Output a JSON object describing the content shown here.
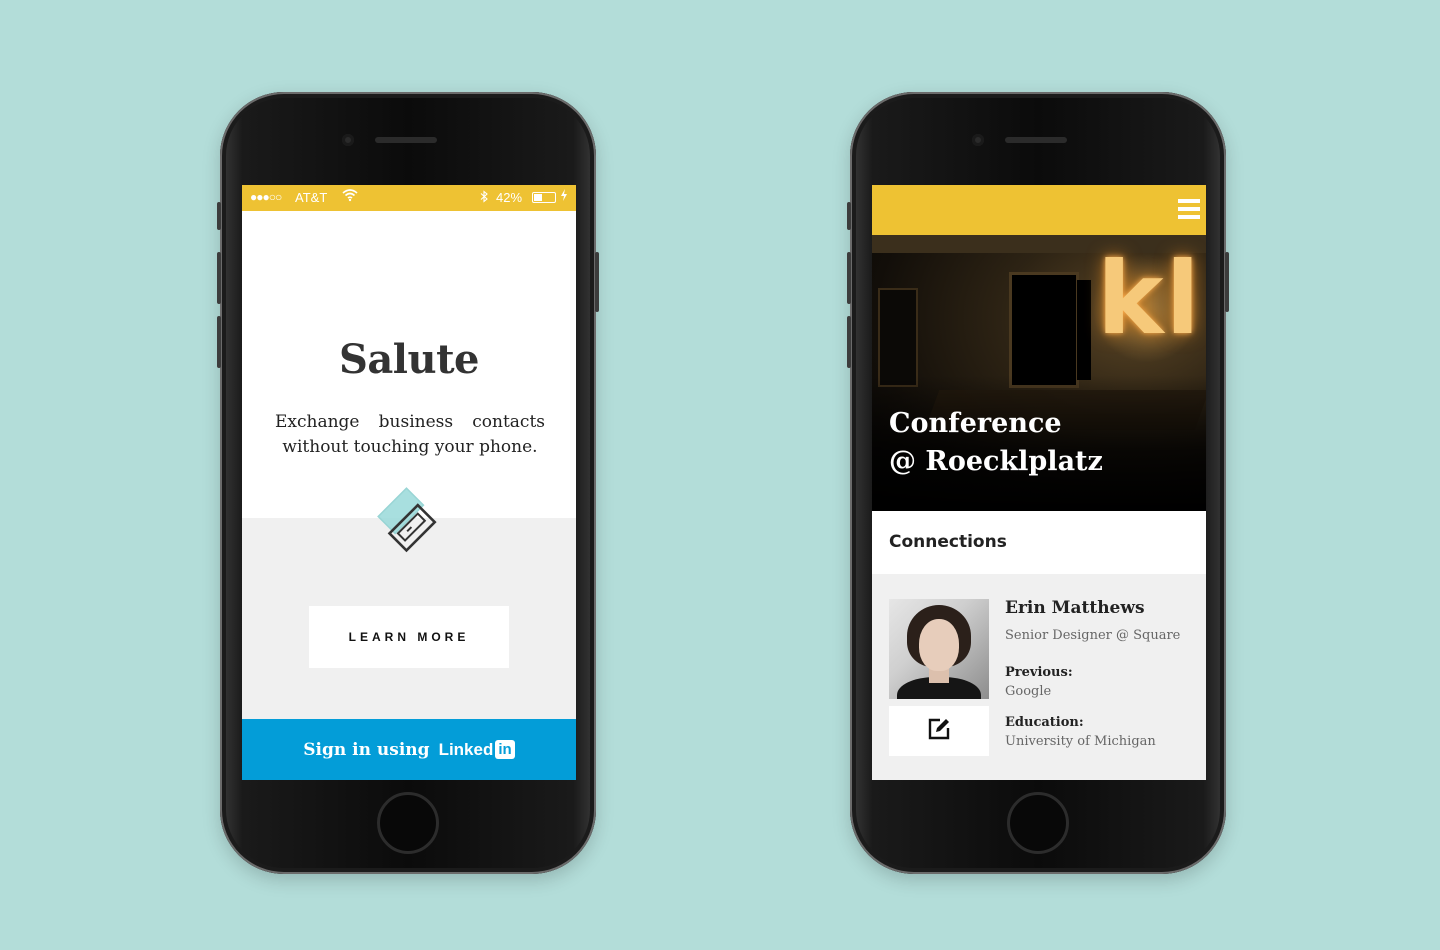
{
  "left_phone": {
    "status_bar": {
      "signal": "●●●○○",
      "carrier": "AT&T",
      "battery_percent": "42%",
      "battery_level": 0.42,
      "background": "#eec233"
    },
    "app_name": "Salute",
    "tagline_line1": "Exchange business contacts",
    "tagline_line2": "without touching your phone.",
    "learn_more_label": "LEARN MORE",
    "sign_in_label": "Sign in using",
    "linkedin_word": "Linked",
    "linkedin_box": "in",
    "sign_in_color": "#039dd8"
  },
  "right_phone": {
    "topbar_color": "#eec233",
    "hero_sign": "kl",
    "event_title_line1": "Conference",
    "event_title_line2": "@ Roecklplatz",
    "connections_heading": "Connections",
    "contact": {
      "name": "Erin Matthews",
      "role": "Senior Designer @ Square",
      "previous_label": "Previous:",
      "previous_value": "Google",
      "education_label": "Education:",
      "education_value": "University of Michigan"
    }
  },
  "icons": [
    "wifi-icon",
    "bluetooth-icon",
    "battery-icon",
    "charging-bolt-icon",
    "handshake-cards-icon",
    "hamburger-menu-icon",
    "edit-icon"
  ]
}
